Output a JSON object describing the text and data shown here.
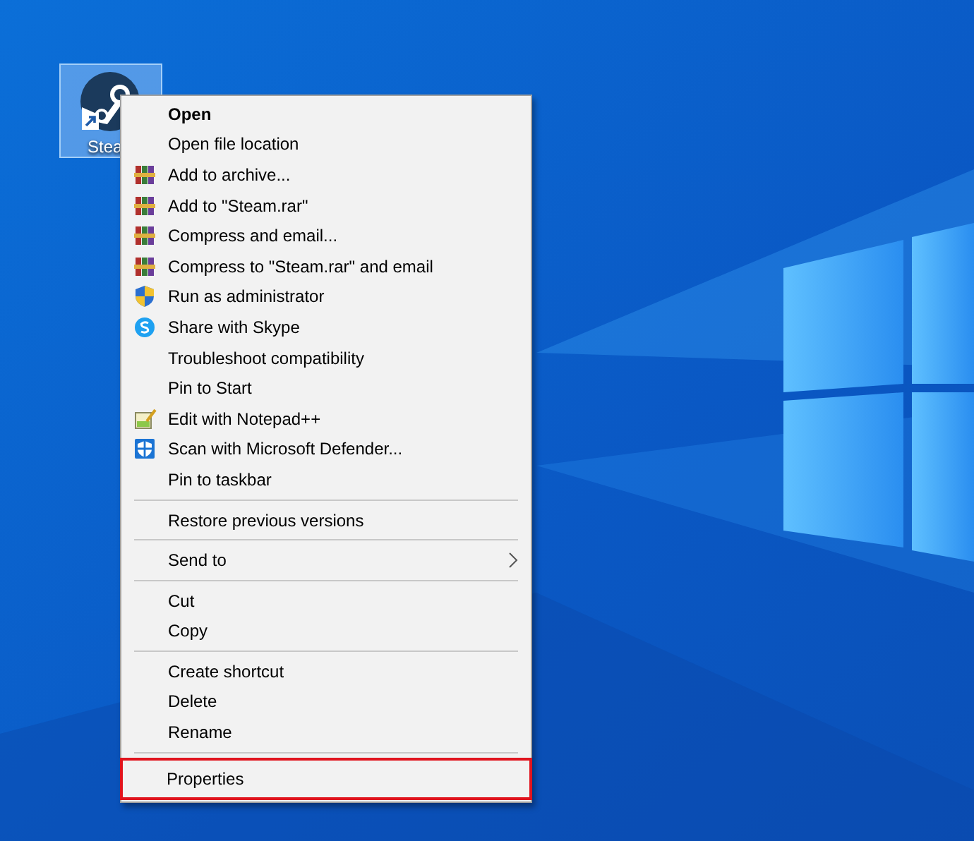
{
  "desktop": {
    "icons": [
      {
        "label": "Stea",
        "selected": true,
        "shortcut": true
      }
    ]
  },
  "context_menu": {
    "sections": [
      {
        "items": [
          {
            "label": "Open",
            "default": true
          },
          {
            "label": "Open file location"
          },
          {
            "label": "Add to archive...",
            "kind": "archive"
          },
          {
            "label": "Add to \"Steam.rar\"",
            "kind": "archive"
          },
          {
            "label": "Compress and email...",
            "kind": "archive"
          },
          {
            "label": "Compress to \"Steam.rar\" and email",
            "kind": "archive"
          },
          {
            "label": "Run as administrator",
            "kind": "shield"
          },
          {
            "label": "Share with Skype",
            "kind": "skype"
          },
          {
            "label": "Troubleshoot compatibility"
          },
          {
            "label": "Pin to Start"
          },
          {
            "label": "Edit with Notepad++",
            "kind": "notepad"
          },
          {
            "label": "Scan with Microsoft Defender...",
            "kind": "defender"
          },
          {
            "label": "Pin to taskbar"
          }
        ]
      },
      {
        "items": [
          {
            "label": "Restore previous versions"
          }
        ]
      },
      {
        "items": [
          {
            "label": "Send to",
            "submenu": true
          }
        ]
      },
      {
        "items": [
          {
            "label": "Cut"
          },
          {
            "label": "Copy"
          }
        ]
      },
      {
        "items": [
          {
            "label": "Create shortcut"
          },
          {
            "label": "Delete"
          },
          {
            "label": "Rename"
          }
        ]
      },
      {
        "items": [
          {
            "label": "Properties",
            "highlighted": true
          }
        ]
      }
    ]
  }
}
